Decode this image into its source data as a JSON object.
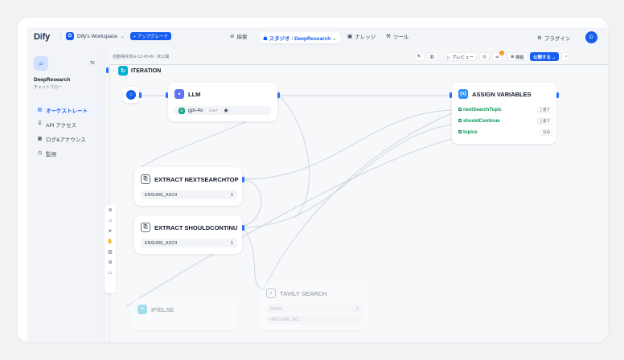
{
  "topbar": {
    "logo_main": "D",
    "logo_accent": "i",
    "logo_rest": "fy",
    "workspace_initial": "D",
    "workspace_name": "Dify's Workspace",
    "upgrade_label": "+ アップグレード",
    "nav_explore": "探索",
    "nav_studio": "スタジオ",
    "project_name": "DeepResearch",
    "nav_knowledge": "ナレッジ",
    "nav_tools": "ツール",
    "plugins": "プラグイン",
    "user_initial": "D"
  },
  "sidebar": {
    "app_name": "DeepResearch",
    "app_type": "チャットフロー",
    "items": [
      {
        "label": "オーケストレート",
        "icon": "orchestrate-icon",
        "glyph": "▤"
      },
      {
        "label": "API アクセス",
        "icon": "api-icon",
        "glyph": "⌸"
      },
      {
        "label": "ログ&アナウンス",
        "icon": "log-icon",
        "glyph": "▦"
      },
      {
        "label": "監視",
        "icon": "monitor-icon",
        "glyph": "◷"
      }
    ]
  },
  "toolbar": {
    "autosave": "自動保存済み 12:43:49 · 未公開",
    "preview": "▷ プレビュー",
    "badge": "2",
    "features": "機能",
    "publish": "公開する ⌄"
  },
  "iteration": {
    "title": "ITERATION"
  },
  "nodes": {
    "llm": {
      "title": "LLM",
      "model": "gpt-4o",
      "mode": "CHAT"
    },
    "assign": {
      "title": "ASSIGN VARIABLES",
      "rows": [
        {
          "name": "nextSearchTopic",
          "op": "上書き"
        },
        {
          "name": "shouldContinue",
          "op": "上書き"
        },
        {
          "name": "topics",
          "op": "追加"
        }
      ]
    },
    "extract1": {
      "title": "EXTRACT NEXTSEARCHTOP",
      "field": "ENSURE_ASCII",
      "value": "1"
    },
    "extract2": {
      "title": "EXTRACT SHOULDCONTINU",
      "field": "ENSURE_ASCII",
      "value": "1"
    },
    "tavily": {
      "title": "TAVILY SEARCH",
      "field": "DAYS",
      "value": "3",
      "field2": "INCLUDE_DO..."
    },
    "ifelse": {
      "title": "IF/ELSE"
    }
  },
  "colors": {
    "accent": "#155eef",
    "llm": "#6172f3",
    "assign": "#2e90fa",
    "iteration": "#06aed4"
  }
}
